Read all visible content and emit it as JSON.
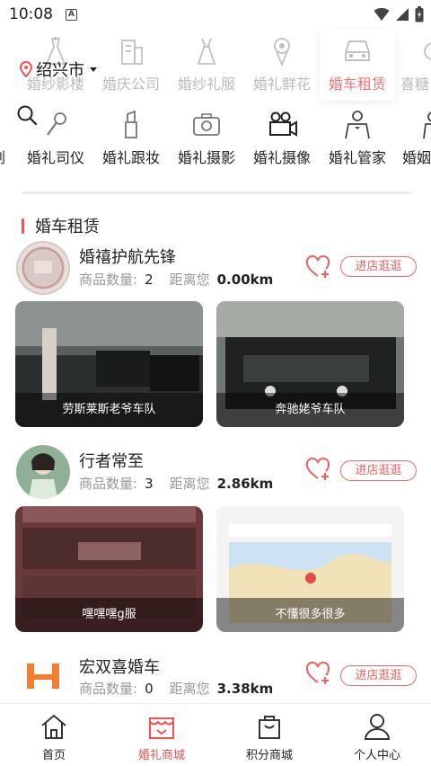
{
  "status_bar": {
    "time": "10:08",
    "indicator": "A"
  },
  "location": {
    "city": "绍兴市"
  },
  "categories_row1": [
    {
      "label": "婚纱影楼",
      "icon": "wedding-dress-icon"
    },
    {
      "label": "婚庆公司",
      "icon": "building-icon"
    },
    {
      "label": "婚纱礼服",
      "icon": "gown-icon"
    },
    {
      "label": "婚礼鲜花",
      "icon": "bouquet-icon"
    },
    {
      "label": "婚车租赁",
      "icon": "car-icon"
    },
    {
      "label": "喜糖",
      "icon": "candy-icon"
    }
  ],
  "categories_row2": [
    {
      "label": "划",
      "icon": ""
    },
    {
      "label": "婚礼司仪",
      "icon": "microphone-icon"
    },
    {
      "label": "婚礼跟妆",
      "icon": "makeup-icon"
    },
    {
      "label": "婚礼摄影",
      "icon": "camera-icon"
    },
    {
      "label": "婚礼摄像",
      "icon": "video-camera-icon"
    },
    {
      "label": "婚礼管家",
      "icon": "butler-icon"
    },
    {
      "label": "婚姻",
      "icon": "person-icon"
    }
  ],
  "section": {
    "title": "婚车租赁"
  },
  "meta_labels": {
    "count": "商品数量:",
    "distance": "距离您"
  },
  "shops": [
    {
      "name": "婚禧护航先锋",
      "count": "2",
      "distance": "0.00km",
      "button": "进店逛逛",
      "photos": [
        {
          "caption": "劳斯莱斯老爷车队"
        },
        {
          "caption": "奔驰姥爷车队"
        }
      ]
    },
    {
      "name": "行者常至",
      "count": "3",
      "distance": "2.86km",
      "button": "进店逛逛",
      "photos": [
        {
          "caption": "嘿嘿嘿g服"
        },
        {
          "caption": "不懂很多很多"
        }
      ]
    },
    {
      "name": "宏双喜婚车",
      "count": "0",
      "distance": "3.38km",
      "button": "进店逛逛",
      "photos": []
    }
  ],
  "nav": [
    {
      "label": "首页",
      "icon": "home-icon"
    },
    {
      "label": "婚礼商城",
      "icon": "shop-icon"
    },
    {
      "label": "积分商城",
      "icon": "bag-icon"
    },
    {
      "label": "个人中心",
      "icon": "user-icon"
    }
  ],
  "colors": {
    "accent": "#f05555",
    "muted": "#999999"
  }
}
